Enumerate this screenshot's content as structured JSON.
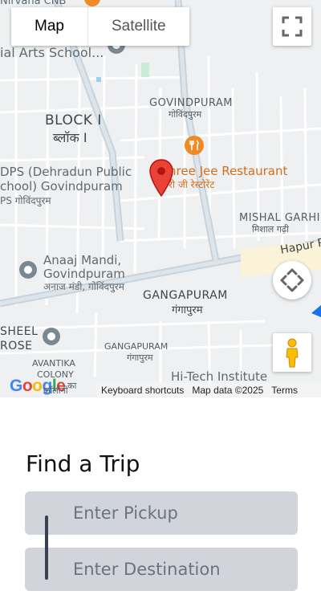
{
  "map": {
    "type_buttons": [
      {
        "label": "Map",
        "active": true
      },
      {
        "label": "Satellite",
        "active": false
      }
    ],
    "labels": {
      "nirvana": "Nirvana CNB",
      "arts_school": "ial Arts School...",
      "block_i": "BLOCK I",
      "block_i_hi": "ब्लॉक I",
      "govindpuram": "GOVINDPURAM",
      "govindpuram_hi": "गोविंदपुरम",
      "dps_line1": "DPS (Dehradun Public",
      "dps_line2": "chool) Govindpuram",
      "dps_hi": "PS गोविंदपुरम",
      "restaurant": "hree Jee Restaurant",
      "restaurant_hi": "री जी रेस्टोरेंट",
      "mishal": "MISHAL GARHI",
      "mishal_hi": "मिशाल गढ़ी",
      "hapur": "Hapur R",
      "anaaj_line1": "Anaaj Mandi,",
      "anaaj_line2": "Govindpuram",
      "anaaj_hi": "अनाज मंडी, गोविंदपुरम",
      "gangapuram": "GANGAPURAM",
      "gangapuram_hi": "गंगापुरम",
      "sheel": "SHEEL",
      "rose": "ROSE",
      "gangapuram_small": "GANGAPURAM",
      "gangapuram_small_hi": "गंगापुरम",
      "avantika": "AVANTIKA",
      "colony": "COLONY",
      "colony_hi": "कॉलोनी",
      "hitech": "Hi-Tech Institute",
      "google_ka": "का"
    },
    "google_logo": "Google",
    "attribution": {
      "shortcuts": "Keyboard shortcuts",
      "data": "Map data ©2025",
      "terms": "Terms"
    },
    "icons": [
      "fullscreen-icon",
      "recenter-icon",
      "pegman-icon",
      "marker-icon"
    ]
  },
  "trip": {
    "title": "Find a Trip",
    "pickup_placeholder": "Enter Pickup",
    "destination_placeholder": "Enter Destination"
  },
  "colors": {
    "marker": "#ea4335",
    "restaurant": "#f08a24",
    "input_bg": "#d1d5db",
    "connector": "#374151"
  }
}
